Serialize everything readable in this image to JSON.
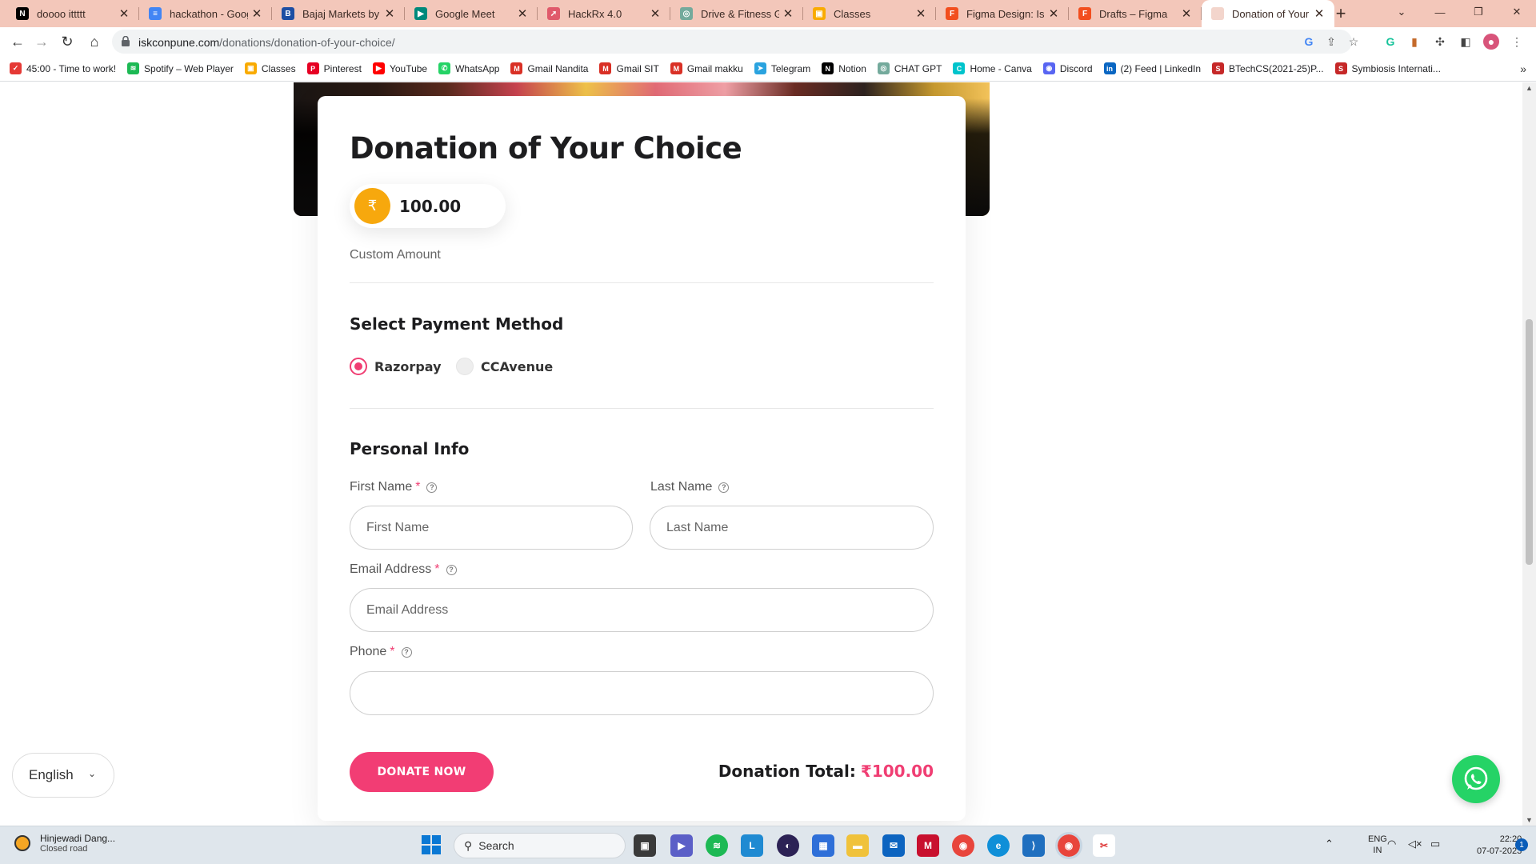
{
  "browser": {
    "tabs": [
      {
        "title": "doooo ittttt",
        "icon": "notion-icon",
        "color": "#000000",
        "glyph": "N"
      },
      {
        "title": "hackathon - Google",
        "icon": "google-docs-icon",
        "color": "#4285f4",
        "glyph": "≡"
      },
      {
        "title": "Bajaj Markets by B",
        "icon": "bajaj-icon",
        "color": "#1d4ea3",
        "glyph": "B"
      },
      {
        "title": "Google Meet",
        "icon": "google-meet-icon",
        "color": "#00897b",
        "glyph": "▶"
      },
      {
        "title": "HackRx 4.0",
        "icon": "rocket-icon",
        "color": "#e05a6b",
        "glyph": "➚"
      },
      {
        "title": "Drive & Fitness Ga",
        "icon": "chatgpt-icon",
        "color": "#74aa9c",
        "glyph": "◎"
      },
      {
        "title": "Classes",
        "icon": "google-classroom-icon",
        "color": "#f9ab00",
        "glyph": "▣"
      },
      {
        "title": "Figma Design: Isk",
        "icon": "figma-icon",
        "color": "#f24e1e",
        "glyph": "F"
      },
      {
        "title": "Drafts – Figma",
        "icon": "figma-icon",
        "color": "#f24e1e",
        "glyph": "F"
      },
      {
        "title": "Donation of Your C",
        "icon": "site-icon",
        "color": "#f3d5cc",
        "glyph": ""
      }
    ],
    "url_host": "iskconpune.com",
    "url_path": "/donations/donation-of-your-choice/"
  },
  "bookmarks": [
    {
      "label": "45:00 - Time to work!",
      "icon": "timer-icon",
      "color": "#e53935",
      "glyph": "✓"
    },
    {
      "label": "Spotify – Web Player",
      "icon": "spotify-icon",
      "color": "#1db954",
      "glyph": "≋"
    },
    {
      "label": "Classes",
      "icon": "google-classroom-icon",
      "color": "#f9ab00",
      "glyph": "▣"
    },
    {
      "label": "Pinterest",
      "icon": "pinterest-icon",
      "color": "#e60023",
      "glyph": "P"
    },
    {
      "label": "YouTube",
      "icon": "youtube-icon",
      "color": "#ff0000",
      "glyph": "▶"
    },
    {
      "label": "WhatsApp",
      "icon": "whatsapp-icon",
      "color": "#25d366",
      "glyph": "✆"
    },
    {
      "label": "Gmail Nandita",
      "icon": "gmail-icon",
      "color": "#d93025",
      "glyph": "M"
    },
    {
      "label": "Gmail SIT",
      "icon": "gmail-icon",
      "color": "#d93025",
      "glyph": "M"
    },
    {
      "label": "Gmail makku",
      "icon": "gmail-icon",
      "color": "#d93025",
      "glyph": "M"
    },
    {
      "label": "Telegram",
      "icon": "telegram-icon",
      "color": "#2aa3df",
      "glyph": "➤"
    },
    {
      "label": "Notion",
      "icon": "notion-icon",
      "color": "#000000",
      "glyph": "N"
    },
    {
      "label": "CHAT GPT",
      "icon": "chatgpt-icon",
      "color": "#74aa9c",
      "glyph": "◎"
    },
    {
      "label": "Home - Canva",
      "icon": "canva-icon",
      "color": "#00c4cc",
      "glyph": "C"
    },
    {
      "label": "Discord",
      "icon": "discord-icon",
      "color": "#5865f2",
      "glyph": "◉"
    },
    {
      "label": "(2) Feed | LinkedIn",
      "icon": "linkedin-icon",
      "color": "#0a66c2",
      "glyph": "in"
    },
    {
      "label": "BTechCS(2021-25)P...",
      "icon": "symbiosis-icon",
      "color": "#c62828",
      "glyph": "S"
    },
    {
      "label": "Symbiosis Internati...",
      "icon": "symbiosis-icon",
      "color": "#c62828",
      "glyph": "S"
    }
  ],
  "form": {
    "title": "Donation of Your Choice",
    "currency_symbol": "₹",
    "amount": "100.00",
    "custom_amount_label": "Custom Amount",
    "payment_section_title": "Select Payment Method",
    "payment_methods": [
      {
        "label": "Razorpay",
        "selected": true
      },
      {
        "label": "CCAvenue",
        "selected": false
      }
    ],
    "personal_section_title": "Personal Info",
    "required_mark": "*",
    "help_glyph": "?",
    "first_name": {
      "label": "First Name",
      "placeholder": "First Name",
      "value": ""
    },
    "last_name": {
      "label": "Last Name",
      "placeholder": "Last Name",
      "value": ""
    },
    "email": {
      "label": "Email Address",
      "placeholder": "Email Address",
      "value": ""
    },
    "phone": {
      "label": "Phone",
      "placeholder": "",
      "value": ""
    },
    "donate_button": "DONATE NOW",
    "total_label": "Donation Total:",
    "total_value": "₹100.00",
    "accent_color": "#f03e73",
    "coin_color": "#f7a80d"
  },
  "page_widgets": {
    "language": "English",
    "whatsapp_color": "#25d366"
  },
  "taskbar": {
    "weather_title": "Hinjewadi Dang...",
    "weather_subtitle": "Closed road",
    "search_placeholder": "Search",
    "lang_line1": "ENG",
    "lang_line2": "IN",
    "time": "22:20",
    "date": "07-07-2023",
    "notification_count": "1"
  }
}
